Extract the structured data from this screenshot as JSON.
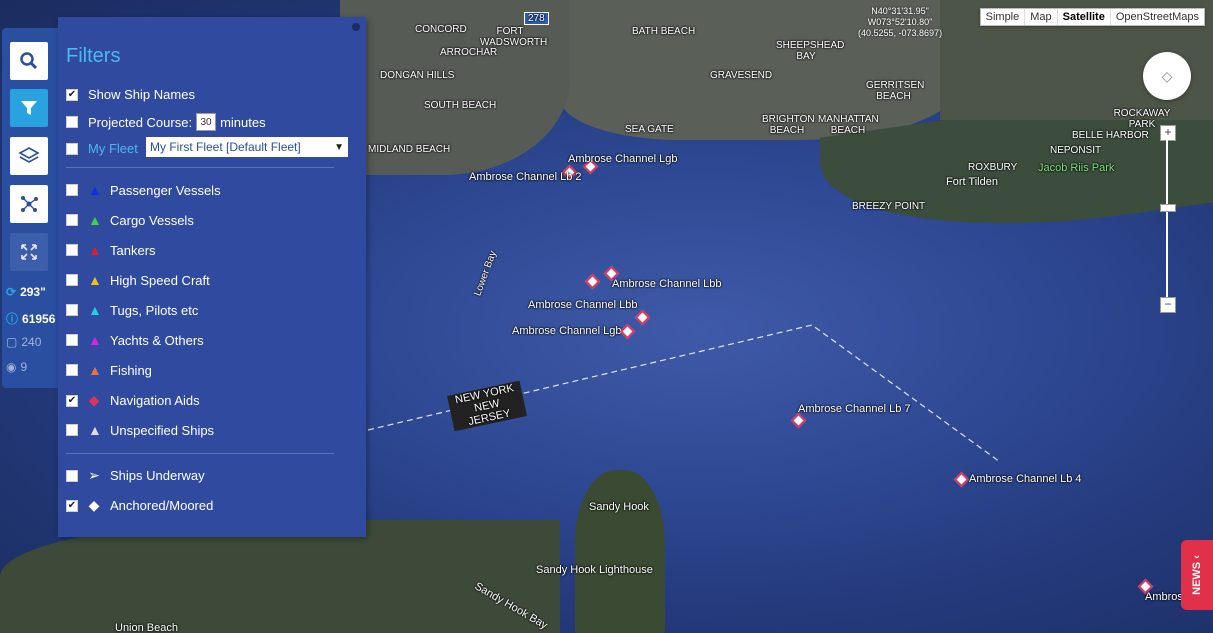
{
  "map": {
    "type_buttons": [
      "Simple",
      "Map",
      "Satellite",
      "OpenStreetMaps"
    ],
    "active_type": "Satellite",
    "coords": [
      "N40°31'31.95\"",
      "W073°52'10.80\"",
      "(40.5255, -073.8697)"
    ],
    "zoom_in": "+",
    "zoom_out": "−",
    "news_label": "NEWS ‹",
    "place_labels": {
      "concord": "CONCORD",
      "fort_wadsworth": "FORT WADSWORTH",
      "arrochar": "ARROCHAR",
      "dongan_hills": "DONGAN HILLS",
      "south_beach": "SOUTH BEACH",
      "midland_beach": "MIDLAND BEACH",
      "bath_beach": "BATH BEACH",
      "sheepshead_bay": "SHEEPSHEAD BAY",
      "gravesend": "GRAVESEND",
      "sea_gate": "SEA GATE",
      "brighton_beach": "BRIGHTON BEACH",
      "manhattan_beach": "MANHATTAN BEACH",
      "gerritsen_beach": "GERRITSEN BEACH",
      "rockaway_park": "ROCKAWAY PARK",
      "belle_harbor": "BELLE HARBOR",
      "neponsit": "NEPONSIT",
      "roxbury": "ROXBURY",
      "fort_tilden": "Fort Tilden",
      "jacob_riis": "Jacob Riis Park",
      "breezy_point": "BREEZY POINT",
      "lower_bay": "Lower Bay",
      "ny_nj": "NEW YORK NEW JERSEY",
      "sandy_hook": "Sandy Hook",
      "sandy_hook_lighthouse": "Sandy Hook Lighthouse",
      "sandy_hook_bay": "Sandy Hook Bay",
      "union_beach": "Union Beach",
      "road_278": "278"
    },
    "aids": [
      "Ambrose Channel Lgb",
      "Ambrose Channel Lb 2",
      "Ambrose Channel Lbb",
      "Ambrose Channel Lbb",
      "Ambrose Channel Lgb",
      "Ambrose Channel Lb 7",
      "Ambrose Channel Lb 4",
      "Ambros"
    ]
  },
  "toolbar": {
    "stats": [
      {
        "icon": "refresh-icon",
        "value": "293\""
      },
      {
        "icon": "info-icon",
        "value": "61956"
      },
      {
        "icon": "square-icon",
        "value": "240"
      },
      {
        "icon": "eye-icon",
        "value": "9"
      }
    ]
  },
  "filters": {
    "title": "Filters",
    "show_ship_names": "Show Ship Names",
    "projected_course": "Projected Course:",
    "projected_minutes_value": "30",
    "minutes": "minutes",
    "my_fleet": "My Fleet",
    "fleet_selected": "My First Fleet  [Default Fleet]",
    "types": [
      {
        "label": "Passenger Vessels",
        "color": "#1030e0",
        "checked": false
      },
      {
        "label": "Cargo Vessels",
        "color": "#40d040",
        "checked": false
      },
      {
        "label": "Tankers",
        "color": "#e02020",
        "checked": false
      },
      {
        "label": "High Speed Craft",
        "color": "#f0c020",
        "checked": false
      },
      {
        "label": "Tugs, Pilots etc",
        "color": "#20d0e0",
        "checked": false
      },
      {
        "label": "Yachts & Others",
        "color": "#e020e0",
        "checked": false
      },
      {
        "label": "Fishing",
        "color": "#f07040",
        "checked": false
      },
      {
        "label": "Navigation Aids",
        "color": "#e0335a",
        "checked": true
      },
      {
        "label": "Unspecified Ships",
        "color": "#dddddd",
        "checked": false
      }
    ],
    "ships_underway": "Ships Underway",
    "anchored_moored": "Anchored/Moored"
  }
}
